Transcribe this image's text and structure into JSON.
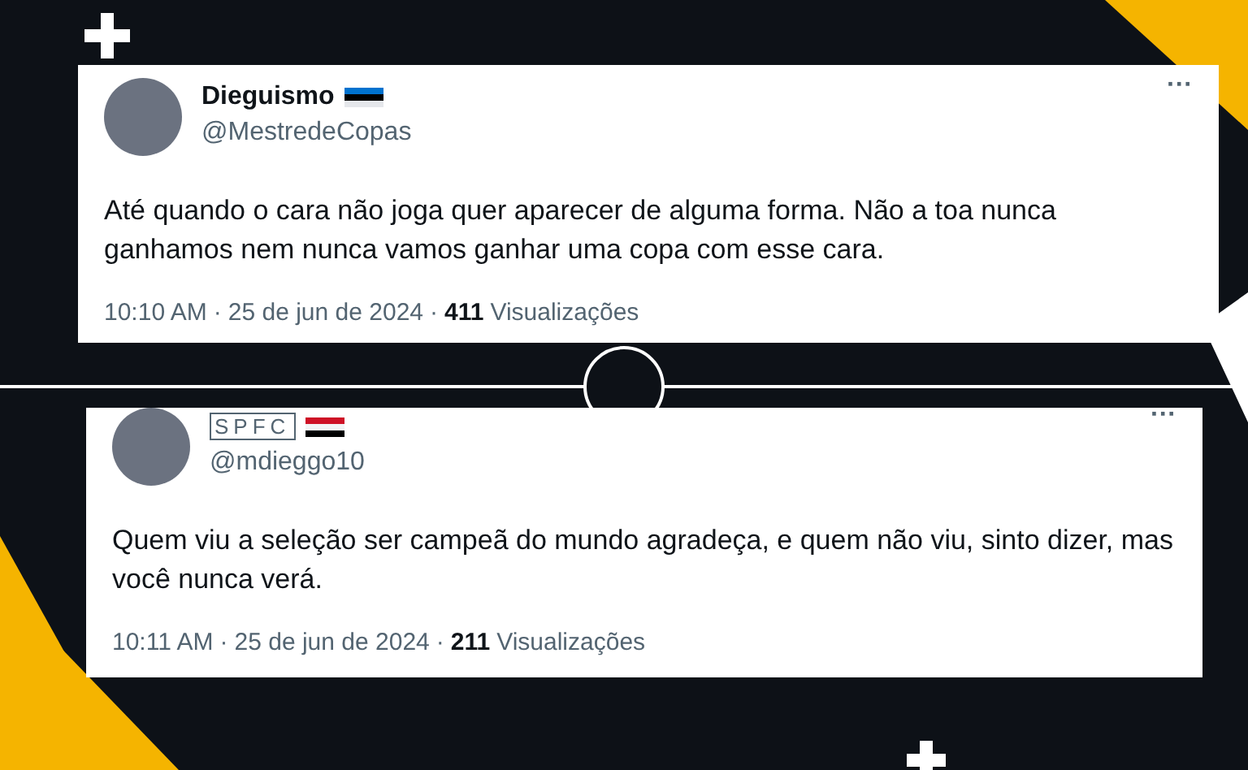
{
  "tweets": [
    {
      "kind": "plain",
      "display_name": "Dieguismo",
      "handle": "@MestredeCopas",
      "flag": {
        "kind": "estonia"
      },
      "more": "···",
      "text": "Até quando o cara não joga quer aparecer de alguma forma. Não a toa nunca ganhamos nem nunca vamos ganhar uma copa com esse cara.",
      "time": "10:10 AM",
      "separator_1": "·",
      "date": "25 de jun de 2024",
      "separator_2": "·",
      "views_count": "411",
      "views_label": "Visualizações"
    },
    {
      "kind": "boxed",
      "display_name": "SPFC",
      "handle": "@mdieggo10",
      "flag": {
        "kind": "red-white-black"
      },
      "more": "···",
      "text": "Quem viu a seleção ser campeã do mundo agradeça, e quem não viu, sinto dizer, mas você nunca verá.",
      "time": "10:11 AM",
      "separator_1": "·",
      "date": "25 de jun de 2024",
      "separator_2": "·",
      "views_count": "211",
      "views_label": "Visualizações"
    }
  ]
}
